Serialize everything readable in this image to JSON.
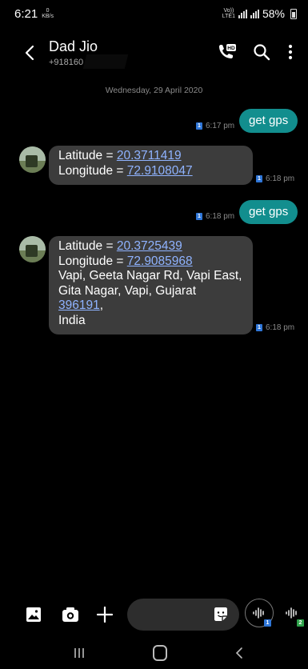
{
  "status": {
    "time": "6:21",
    "speed_value": "0",
    "speed_unit": "KB/s",
    "volte": "Vo))",
    "lte": "LTE1",
    "battery": "58%"
  },
  "header": {
    "name": "Dad Jio",
    "number": "+918160",
    "icons": [
      "back-icon",
      "hd-call-icon",
      "search-icon",
      "menu-icon"
    ]
  },
  "date": "Wednesday, 29 April 2020",
  "messages": [
    {
      "text": "get gps",
      "time": "6:17 pm",
      "sim": "1"
    },
    {
      "lat_label": "Latitude = ",
      "lat": "20.3711419",
      "lon_label": "Longitude = ",
      "lon": "72.9108047",
      "time": "6:18 pm",
      "sim": "1"
    },
    {
      "text": "get gps",
      "time": "6:18 pm",
      "sim": "1"
    },
    {
      "lat_label": "Latitude = ",
      "lat": "20.3725439",
      "lon_label": "Longitude = ",
      "lon": "72.9085968",
      "address1": "Vapi, Geeta Nagar Rd, Vapi East,",
      "address2": "Gita Nagar, Vapi, Gujarat ",
      "pin": "396191",
      "address3": ",",
      "address4": "India",
      "time": "6:18 pm",
      "sim": "1"
    }
  ],
  "composer": {
    "placeholder": "",
    "sim1": "1",
    "sim2": "2"
  },
  "colors": {
    "outgoing": "#128e8e",
    "incoming": "#3c3c3c",
    "link": "#8fb3ff",
    "sim1": "#2f76d8",
    "sim2": "#2fa34b"
  }
}
